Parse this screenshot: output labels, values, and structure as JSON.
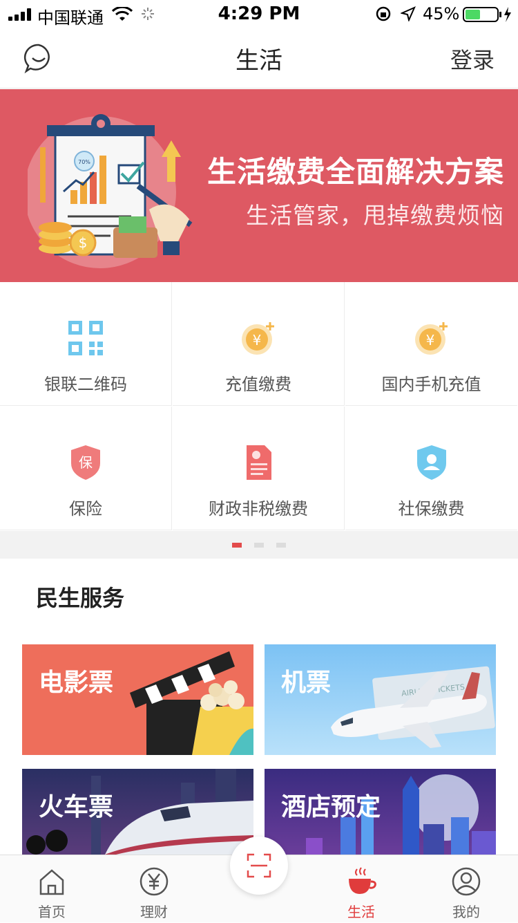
{
  "status_bar": {
    "carrier": "中国联通",
    "time": "4:29 PM",
    "battery": "45%"
  },
  "header": {
    "title": "生活",
    "login_label": "登录"
  },
  "banner": {
    "headline": "生活缴费全面解决方案",
    "subline": "生活管家，甩掉缴费烦恼",
    "chart_label": "70%"
  },
  "services": [
    {
      "label": "银联二维码",
      "icon": "qrcode-icon"
    },
    {
      "label": "充值缴费",
      "icon": "coin-plus-icon"
    },
    {
      "label": "国内手机充值",
      "icon": "coin-plus-icon"
    },
    {
      "label": "保险",
      "icon": "insurance-shield-icon"
    },
    {
      "label": "财政非税缴费",
      "icon": "document-icon"
    },
    {
      "label": "社保缴费",
      "icon": "social-security-icon"
    }
  ],
  "pager": {
    "pages": 3,
    "active": 0
  },
  "section": {
    "title": "民生服务"
  },
  "cards": [
    {
      "title": "电影票",
      "color": "#ee6e5b"
    },
    {
      "title": "机票",
      "color": "#8ec9f2",
      "ticket_text": "AIRLINE TICKETS"
    },
    {
      "title": "火车票",
      "color": "#2b2f5c"
    },
    {
      "title": "酒店预定",
      "color": "#3b2a7a"
    }
  ],
  "tabs": [
    {
      "label": "首页",
      "icon": "home-icon"
    },
    {
      "label": "理财",
      "icon": "yen-circle-icon"
    },
    {
      "label": "生活",
      "icon": "coffee-cup-icon",
      "active": true
    },
    {
      "label": "我的",
      "icon": "user-circle-icon"
    }
  ],
  "colors": {
    "accent": "#e03c3c",
    "banner_bg": "#de5963"
  }
}
